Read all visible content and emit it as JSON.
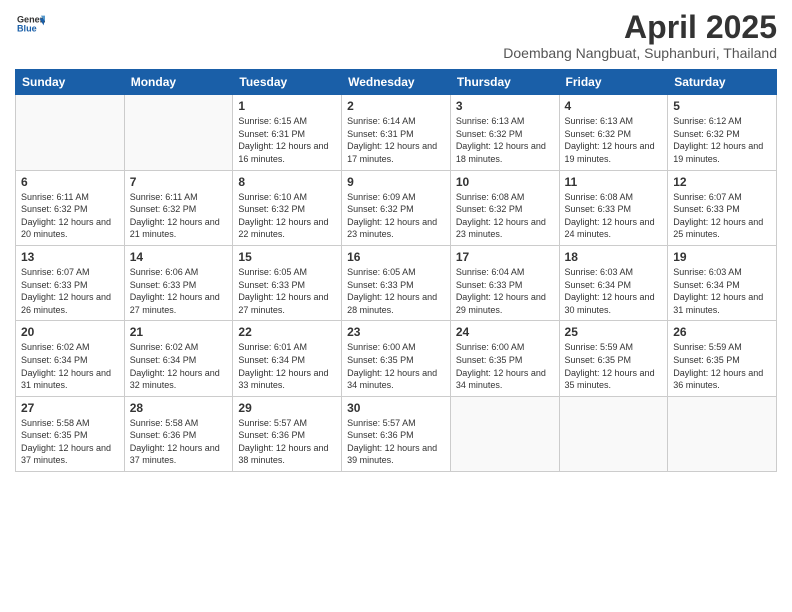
{
  "logo": {
    "general": "General",
    "blue": "Blue"
  },
  "header": {
    "title": "April 2025",
    "subtitle": "Doembang Nangbuat, Suphanburi, Thailand"
  },
  "weekdays": [
    "Sunday",
    "Monday",
    "Tuesday",
    "Wednesday",
    "Thursday",
    "Friday",
    "Saturday"
  ],
  "weeks": [
    [
      {
        "day": "",
        "info": ""
      },
      {
        "day": "",
        "info": ""
      },
      {
        "day": "1",
        "info": "Sunrise: 6:15 AM\nSunset: 6:31 PM\nDaylight: 12 hours and 16 minutes."
      },
      {
        "day": "2",
        "info": "Sunrise: 6:14 AM\nSunset: 6:31 PM\nDaylight: 12 hours and 17 minutes."
      },
      {
        "day": "3",
        "info": "Sunrise: 6:13 AM\nSunset: 6:32 PM\nDaylight: 12 hours and 18 minutes."
      },
      {
        "day": "4",
        "info": "Sunrise: 6:13 AM\nSunset: 6:32 PM\nDaylight: 12 hours and 19 minutes."
      },
      {
        "day": "5",
        "info": "Sunrise: 6:12 AM\nSunset: 6:32 PM\nDaylight: 12 hours and 19 minutes."
      }
    ],
    [
      {
        "day": "6",
        "info": "Sunrise: 6:11 AM\nSunset: 6:32 PM\nDaylight: 12 hours and 20 minutes."
      },
      {
        "day": "7",
        "info": "Sunrise: 6:11 AM\nSunset: 6:32 PM\nDaylight: 12 hours and 21 minutes."
      },
      {
        "day": "8",
        "info": "Sunrise: 6:10 AM\nSunset: 6:32 PM\nDaylight: 12 hours and 22 minutes."
      },
      {
        "day": "9",
        "info": "Sunrise: 6:09 AM\nSunset: 6:32 PM\nDaylight: 12 hours and 23 minutes."
      },
      {
        "day": "10",
        "info": "Sunrise: 6:08 AM\nSunset: 6:32 PM\nDaylight: 12 hours and 23 minutes."
      },
      {
        "day": "11",
        "info": "Sunrise: 6:08 AM\nSunset: 6:33 PM\nDaylight: 12 hours and 24 minutes."
      },
      {
        "day": "12",
        "info": "Sunrise: 6:07 AM\nSunset: 6:33 PM\nDaylight: 12 hours and 25 minutes."
      }
    ],
    [
      {
        "day": "13",
        "info": "Sunrise: 6:07 AM\nSunset: 6:33 PM\nDaylight: 12 hours and 26 minutes."
      },
      {
        "day": "14",
        "info": "Sunrise: 6:06 AM\nSunset: 6:33 PM\nDaylight: 12 hours and 27 minutes."
      },
      {
        "day": "15",
        "info": "Sunrise: 6:05 AM\nSunset: 6:33 PM\nDaylight: 12 hours and 27 minutes."
      },
      {
        "day": "16",
        "info": "Sunrise: 6:05 AM\nSunset: 6:33 PM\nDaylight: 12 hours and 28 minutes."
      },
      {
        "day": "17",
        "info": "Sunrise: 6:04 AM\nSunset: 6:33 PM\nDaylight: 12 hours and 29 minutes."
      },
      {
        "day": "18",
        "info": "Sunrise: 6:03 AM\nSunset: 6:34 PM\nDaylight: 12 hours and 30 minutes."
      },
      {
        "day": "19",
        "info": "Sunrise: 6:03 AM\nSunset: 6:34 PM\nDaylight: 12 hours and 31 minutes."
      }
    ],
    [
      {
        "day": "20",
        "info": "Sunrise: 6:02 AM\nSunset: 6:34 PM\nDaylight: 12 hours and 31 minutes."
      },
      {
        "day": "21",
        "info": "Sunrise: 6:02 AM\nSunset: 6:34 PM\nDaylight: 12 hours and 32 minutes."
      },
      {
        "day": "22",
        "info": "Sunrise: 6:01 AM\nSunset: 6:34 PM\nDaylight: 12 hours and 33 minutes."
      },
      {
        "day": "23",
        "info": "Sunrise: 6:00 AM\nSunset: 6:35 PM\nDaylight: 12 hours and 34 minutes."
      },
      {
        "day": "24",
        "info": "Sunrise: 6:00 AM\nSunset: 6:35 PM\nDaylight: 12 hours and 34 minutes."
      },
      {
        "day": "25",
        "info": "Sunrise: 5:59 AM\nSunset: 6:35 PM\nDaylight: 12 hours and 35 minutes."
      },
      {
        "day": "26",
        "info": "Sunrise: 5:59 AM\nSunset: 6:35 PM\nDaylight: 12 hours and 36 minutes."
      }
    ],
    [
      {
        "day": "27",
        "info": "Sunrise: 5:58 AM\nSunset: 6:35 PM\nDaylight: 12 hours and 37 minutes."
      },
      {
        "day": "28",
        "info": "Sunrise: 5:58 AM\nSunset: 6:36 PM\nDaylight: 12 hours and 37 minutes."
      },
      {
        "day": "29",
        "info": "Sunrise: 5:57 AM\nSunset: 6:36 PM\nDaylight: 12 hours and 38 minutes."
      },
      {
        "day": "30",
        "info": "Sunrise: 5:57 AM\nSunset: 6:36 PM\nDaylight: 12 hours and 39 minutes."
      },
      {
        "day": "",
        "info": ""
      },
      {
        "day": "",
        "info": ""
      },
      {
        "day": "",
        "info": ""
      }
    ]
  ]
}
